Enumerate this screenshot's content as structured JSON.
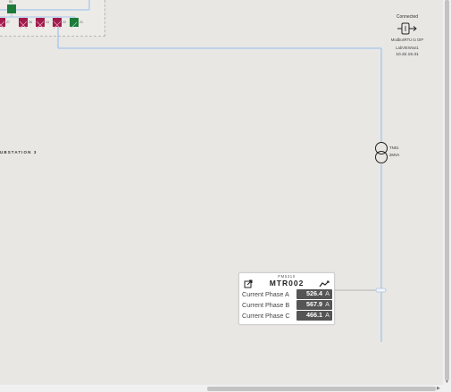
{
  "colors": {
    "line": "#a6c5ec",
    "breaker_closed": "#1d7b3a",
    "breaker_open": "#a01a4b",
    "value_bg": "#555555"
  },
  "top_panel": {
    "feeder_label": "01",
    "breakers": [
      {
        "label": "27",
        "state": "open"
      },
      {
        "label": "26",
        "state": "open"
      },
      {
        "label": "24",
        "state": "open"
      },
      {
        "label": "22",
        "state": "open"
      },
      {
        "label": "21",
        "state": "closed"
      }
    ]
  },
  "substation_label": "UBSTATION 3",
  "connection": {
    "title": "Connected",
    "subtitle": "ModbusRTU to OIP",
    "detail": "LabVIEWout1",
    "ip": "10.32.15.31",
    "icon": "gateway-icon"
  },
  "transformer": {
    "name": "TN01",
    "rating": "2MVA",
    "icon": "transformer-icon"
  },
  "meter": {
    "model": "PM5310",
    "name": "MTR002",
    "open_icon": "external-link-icon",
    "trend_icon": "trend-chart-icon",
    "readings": [
      {
        "label": "Current Phase A",
        "value": "526.4",
        "unit": "A"
      },
      {
        "label": "Current Phase B",
        "value": "567.9",
        "unit": "A"
      },
      {
        "label": "Current Phase C",
        "value": "466.1",
        "unit": "A"
      }
    ]
  }
}
